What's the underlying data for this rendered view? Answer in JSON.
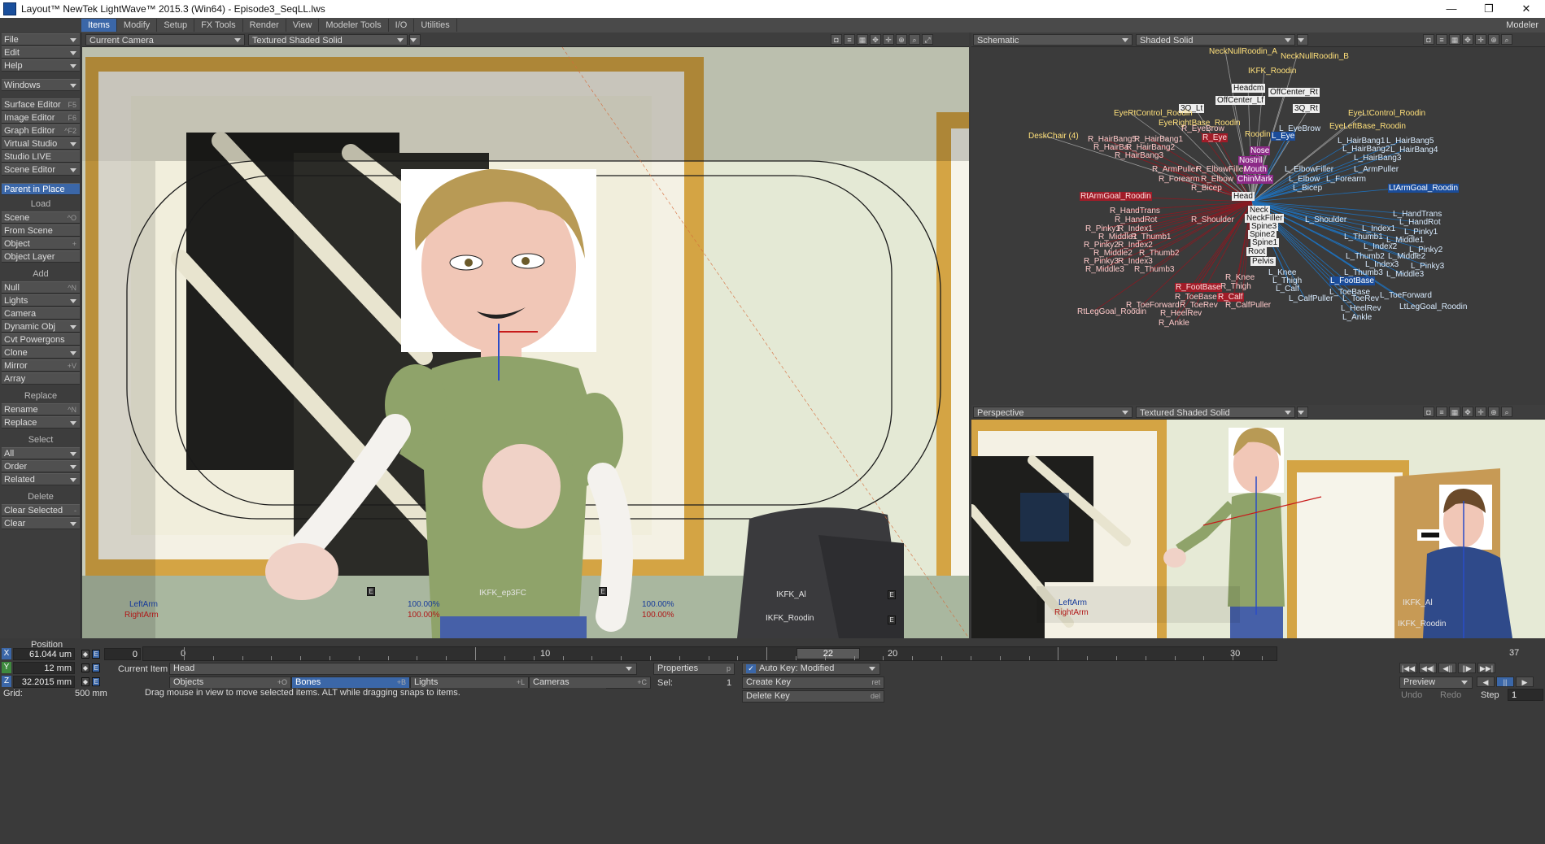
{
  "title": "Layout™ NewTek LightWave™ 2015.3 (Win64) - Episode3_SeqLL.lws",
  "window_buttons": {
    "minimize": "—",
    "restore": "❐",
    "close": "✕"
  },
  "menu_tabs": [
    "Items",
    "Modify",
    "Setup",
    "FX Tools",
    "Render",
    "View",
    "Modeler Tools",
    "I/O",
    "Utilities"
  ],
  "modeler_label": "Modeler",
  "sidebar": {
    "top": [
      {
        "label": "File",
        "dd": true
      },
      {
        "label": "Edit",
        "dd": true
      },
      {
        "label": "Help",
        "dd": true
      }
    ],
    "windows": {
      "label": "Windows",
      "dd": true
    },
    "editors": [
      {
        "label": "Surface Editor",
        "sc": "F5"
      },
      {
        "label": "Image Editor",
        "sc": "F6"
      },
      {
        "label": "Graph Editor",
        "sc": "^F2"
      },
      {
        "label": "Virtual Studio",
        "dd": true
      },
      {
        "label": "Studio LIVE"
      },
      {
        "label": "Scene Editor",
        "dd": true
      }
    ],
    "parent_in_place": "Parent in Place",
    "load_header": "Load",
    "load": [
      {
        "label": "Scene",
        "sc": "^O"
      },
      {
        "label": "From Scene"
      },
      {
        "label": "Object",
        "sc": "+"
      },
      {
        "label": "Object Layer"
      }
    ],
    "add_header": "Add",
    "add": [
      {
        "label": "Null",
        "sc": "^N"
      },
      {
        "label": "Lights",
        "dd": true
      },
      {
        "label": "Camera"
      },
      {
        "label": "Dynamic Obj",
        "dd": true
      },
      {
        "label": "Cvt Powergons"
      },
      {
        "label": "Clone",
        "dd": true
      },
      {
        "label": "Mirror",
        "sc": "+V"
      },
      {
        "label": "Array"
      }
    ],
    "replace_header": "Replace",
    "replace": [
      {
        "label": "Rename",
        "sc": "^N"
      },
      {
        "label": "Replace",
        "dd": true
      }
    ],
    "select_header": "Select",
    "select": [
      {
        "label": "All",
        "dd": true
      },
      {
        "label": "Order",
        "dd": true
      },
      {
        "label": "Related",
        "dd": true
      }
    ],
    "delete_header": "Delete",
    "delete": [
      {
        "label": "Clear Selected",
        "sc": "-"
      },
      {
        "label": "Clear",
        "dd": true
      }
    ]
  },
  "viewports": {
    "main": {
      "view": "Current Camera",
      "shading": "Textured Shaded Solid"
    },
    "schematic": {
      "view": "Schematic",
      "shading": "Shaded Solid"
    },
    "perspective": {
      "view": "Perspective",
      "shading": "Textured Shaded Solid"
    }
  },
  "main_overlay": {
    "ikfk_ep3": "IKFK_ep3FC",
    "ikfk_al": "IKFK_Al",
    "ikfk_roodin": "IKFK_Roodin",
    "left_arm": "LeftArm",
    "right_arm": "RightArm",
    "pct1": "100.00%",
    "pct2": "100.00%",
    "pct3": "100.00%",
    "pct4": "100.00%",
    "e": "E"
  },
  "persp_overlay": {
    "ikfk_al": "IKFK_Al",
    "ikfk_roodin": "IKFK_Roodin",
    "left_arm": "LeftArm",
    "right_arm": "RightArm"
  },
  "schematic_nodes": [
    {
      "t": "NeckNullRoodin_A",
      "c": "ny"
    },
    {
      "t": "NeckNullRoodin_B",
      "c": "ny"
    },
    {
      "t": "IKFK_Roodin",
      "c": "ny"
    },
    {
      "t": "Headcm",
      "c": "nw"
    },
    {
      "t": "OffCenter_Rt",
      "c": "nw"
    },
    {
      "t": "OffCenter_Lf",
      "c": "nw"
    },
    {
      "t": "3Q_Lt",
      "c": "nw"
    },
    {
      "t": "3Q_Rt",
      "c": "nw"
    },
    {
      "t": "EyeRtControl_Roodin",
      "c": "ny"
    },
    {
      "t": "EyeLtControl_Roodin",
      "c": "ny"
    },
    {
      "t": "EyeRightBase_Roodin",
      "c": "ny"
    },
    {
      "t": "EyeLeftBase_Roodin",
      "c": "ny"
    },
    {
      "t": "DeskChair (4)",
      "c": "ny"
    },
    {
      "t": "R_EyeBrow",
      "c": "nrt"
    },
    {
      "t": "L_EyeBrow",
      "c": "nb"
    },
    {
      "t": "R_Eye",
      "c": "nr"
    },
    {
      "t": "L_Eye",
      "c": "nbb"
    },
    {
      "t": "Roodin",
      "c": "ny"
    },
    {
      "t": "R_HairBang5",
      "c": "nrt"
    },
    {
      "t": "R_HairBang1",
      "c": "nrt"
    },
    {
      "t": "R_HairBa",
      "c": "nrt"
    },
    {
      "t": "R_HairBang2",
      "c": "nrt"
    },
    {
      "t": "R_HairBang3",
      "c": "nrt"
    },
    {
      "t": "L_HairBang1",
      "c": "nb"
    },
    {
      "t": "L_HairBang5",
      "c": "nb"
    },
    {
      "t": "L_HairBang2",
      "c": "nb"
    },
    {
      "t": "L_HairBang4",
      "c": "nb"
    },
    {
      "t": "L_HairBang3",
      "c": "nb"
    },
    {
      "t": "Nose",
      "c": "np"
    },
    {
      "t": "Nostril",
      "c": "np"
    },
    {
      "t": "Mouth",
      "c": "np"
    },
    {
      "t": "ChinMark",
      "c": "np"
    },
    {
      "t": "R_ArmPuller",
      "c": "nrt"
    },
    {
      "t": "R_ElbowFiller",
      "c": "nrt"
    },
    {
      "t": "R_Forearm",
      "c": "nrt"
    },
    {
      "t": "R_Elbow",
      "c": "nrt"
    },
    {
      "t": "R_Bicep",
      "c": "nrt"
    },
    {
      "t": "L_ElbowFiller",
      "c": "nb"
    },
    {
      "t": "L_ArmPuller",
      "c": "nb"
    },
    {
      "t": "L_Elbow",
      "c": "nb"
    },
    {
      "t": "L_Forearm",
      "c": "nb"
    },
    {
      "t": "L_Bicep",
      "c": "nb"
    },
    {
      "t": "RtArmGoal_Roodin",
      "c": "nr"
    },
    {
      "t": "LtArmGoal_Roodin",
      "c": "nbb"
    },
    {
      "t": "Head",
      "c": "nw"
    },
    {
      "t": "Neck",
      "c": "nw"
    },
    {
      "t": "NeckFiller",
      "c": "nw"
    },
    {
      "t": "Spine3",
      "c": "nw"
    },
    {
      "t": "Spine2",
      "c": "nw"
    },
    {
      "t": "Spine1",
      "c": "nw"
    },
    {
      "t": "Root",
      "c": "nw"
    },
    {
      "t": "Pelvis",
      "c": "nw"
    },
    {
      "t": "R_HandTrans",
      "c": "nrt"
    },
    {
      "t": "R_HandRot",
      "c": "nrt"
    },
    {
      "t": "R_Shoulder",
      "c": "nrt"
    },
    {
      "t": "L_Shoulder",
      "c": "nb"
    },
    {
      "t": "L_HandTrans",
      "c": "nb"
    },
    {
      "t": "L_HandRot",
      "c": "nb"
    },
    {
      "t": "R_Pinky1",
      "c": "nrt"
    },
    {
      "t": "R_Index1",
      "c": "nrt"
    },
    {
      "t": "R_Middle1",
      "c": "nrt"
    },
    {
      "t": "R_Thumb1",
      "c": "nrt"
    },
    {
      "t": "R_Pinky2",
      "c": "nrt"
    },
    {
      "t": "R_Index2",
      "c": "nrt"
    },
    {
      "t": "R_Middle2",
      "c": "nrt"
    },
    {
      "t": "R_Thumb2",
      "c": "nrt"
    },
    {
      "t": "R_Pinky3",
      "c": "nrt"
    },
    {
      "t": "R_Index3",
      "c": "nrt"
    },
    {
      "t": "R_Middle3",
      "c": "nrt"
    },
    {
      "t": "R_Thumb3",
      "c": "nrt"
    },
    {
      "t": "L_Index1",
      "c": "nb"
    },
    {
      "t": "L_Pinky1",
      "c": "nb"
    },
    {
      "t": "L_Thumb1",
      "c": "nb"
    },
    {
      "t": "L_Middle1",
      "c": "nb"
    },
    {
      "t": "L_Index2",
      "c": "nb"
    },
    {
      "t": "L_Pinky2",
      "c": "nb"
    },
    {
      "t": "L_Thumb2",
      "c": "nb"
    },
    {
      "t": "L_Middle2",
      "c": "nb"
    },
    {
      "t": "L_Index3",
      "c": "nb"
    },
    {
      "t": "L_Pinky3",
      "c": "nb"
    },
    {
      "t": "L_Thumb3",
      "c": "nb"
    },
    {
      "t": "L_Middle3",
      "c": "nb"
    },
    {
      "t": "R_Knee",
      "c": "nrt"
    },
    {
      "t": "R_FootBase",
      "c": "nr"
    },
    {
      "t": "R_Thigh",
      "c": "nrt"
    },
    {
      "t": "R_ToeBase",
      "c": "nrt"
    },
    {
      "t": "R_Calf",
      "c": "nr"
    },
    {
      "t": "R_ToeForward",
      "c": "nrt"
    },
    {
      "t": "R_ToeRev",
      "c": "nrt"
    },
    {
      "t": "R_CalfPuller",
      "c": "nrt"
    },
    {
      "t": "R_HeelRev",
      "c": "nrt"
    },
    {
      "t": "R_Ankle",
      "c": "nrt"
    },
    {
      "t": "L_Knee",
      "c": "nb"
    },
    {
      "t": "L_Thigh",
      "c": "nb"
    },
    {
      "t": "L_FootBase",
      "c": "nbb"
    },
    {
      "t": "L_Calf",
      "c": "nb"
    },
    {
      "t": "L_ToeBase",
      "c": "nb"
    },
    {
      "t": "L_CalfPuller",
      "c": "nb"
    },
    {
      "t": "L_ToeRev",
      "c": "nb"
    },
    {
      "t": "L_ToeForward",
      "c": "nb"
    },
    {
      "t": "L_HeelRev",
      "c": "nb"
    },
    {
      "t": "L_Ankle",
      "c": "nb"
    },
    {
      "t": "RtLegGoal_Roodin",
      "c": "nrt"
    },
    {
      "t": "LtLegGoal_Roodin",
      "c": "nb"
    }
  ],
  "position": {
    "label": "Position",
    "x_axis": "X",
    "y_axis": "Y",
    "z_axis": "Z",
    "x": "61.044 um",
    "y": "12 mm",
    "z": "32.2015 mm",
    "grid_label": "Grid:",
    "grid": "500 mm"
  },
  "timeline": {
    "start": "0",
    "ticks": [
      "0",
      "10",
      "20",
      "30"
    ],
    "current_frame": "22",
    "end": "37"
  },
  "current_item": {
    "label": "Current Item",
    "value": "Head"
  },
  "item_types": [
    {
      "label": "Objects",
      "sc": "+O"
    },
    {
      "label": "Bones",
      "sc": "+B",
      "sel": true
    },
    {
      "label": "Lights",
      "sc": "+L"
    },
    {
      "label": "Cameras",
      "sc": "+C"
    }
  ],
  "properties": {
    "label": "Properties",
    "sc": "p"
  },
  "sel": {
    "label": "Sel:",
    "value": "1"
  },
  "auto_key": {
    "check": "✓",
    "label": "Auto Key: Modified"
  },
  "create_key": {
    "label": "Create Key",
    "sc": "ret"
  },
  "delete_key": {
    "label": "Delete Key",
    "sc": "del"
  },
  "status": "Drag mouse in view to move selected items. ALT while dragging snaps to items.",
  "transport": {
    "row1": [
      "|◀◀",
      "◀◀|",
      "◀||",
      "||▶",
      "▶▶|"
    ],
    "preview": "Preview",
    "undo": "Undo",
    "redo": "Redo",
    "step_label": "Step",
    "step": "1"
  },
  "colors": {
    "accent": "#3b67a8",
    "bg": "#3a3a3a",
    "wall": "#e4ecd2",
    "frame": "#d8a53c",
    "shirt": "#8fa36a"
  }
}
